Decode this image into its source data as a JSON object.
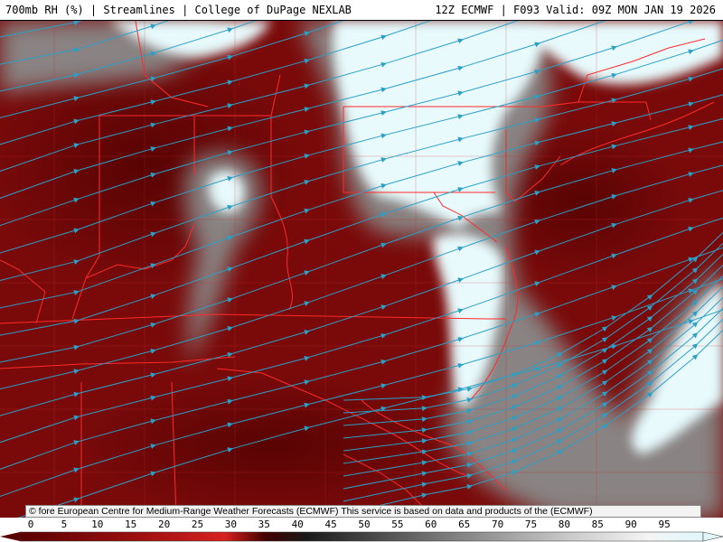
{
  "header": {
    "left_title": "700mb RH (%) | Streamlines | College of DuPage NEXLAB",
    "right_title": "12Z ECMWF | F093 Valid: 09Z MON JAN 19 2026"
  },
  "footer": {
    "copyright": "© fore European Centre for Medium-Range Weather Forecasts (ECMWF)  This service is based on data and products of the (ECMWF)"
  },
  "legend": {
    "ticks": [
      "0",
      "5",
      "10",
      "15",
      "20",
      "25",
      "30",
      "35",
      "40",
      "45",
      "50",
      "55",
      "60",
      "65",
      "70",
      "75",
      "80",
      "85",
      "90",
      "95"
    ],
    "min_value": 0,
    "max_value": 100,
    "colors": {
      "dry": "#6e0000",
      "mid_red": "#c01010",
      "gray_dark": "#303030",
      "gray_light": "#d0d0d0",
      "moist": "#e8fafc"
    }
  },
  "map": {
    "field": "700mb relative humidity",
    "overlay": "streamlines",
    "region": "Eastern United States",
    "colors": {
      "boundaries": "#ff2a2a",
      "streamlines": "#2aa0c8",
      "dry_fill": "#7a0a0a",
      "moist_fill": "#e8fafc"
    }
  }
}
